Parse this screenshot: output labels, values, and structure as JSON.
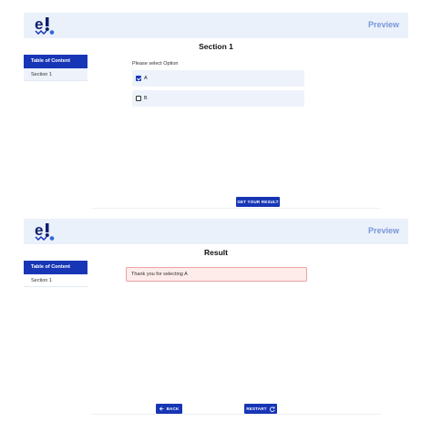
{
  "section_page": {
    "header": {
      "preview_label": "Preview"
    },
    "title": "Section 1",
    "sidebar": {
      "heading": "Table of Content",
      "items": [
        {
          "label": "Section 1"
        }
      ]
    },
    "question": "Please select Option",
    "options": [
      {
        "label": "A",
        "checked": true
      },
      {
        "label": "B",
        "checked": false
      }
    ],
    "submit_label": "GET YOUR RESULT"
  },
  "result_page": {
    "header": {
      "preview_label": "Preview"
    },
    "title": "Result",
    "sidebar": {
      "heading": "Table of Content",
      "items": [
        {
          "label": "Section 1"
        }
      ]
    },
    "message": "Thank you for selecting A",
    "back_label": "BACK",
    "restart_label": "RESTART"
  },
  "colors": {
    "primary": "#1736b6",
    "header_bg": "#eaf1fb",
    "preview_text": "#7a96d8",
    "result_bg": "#fdecea",
    "result_border": "#e8a3a0"
  },
  "icons": {
    "logo": "e!-logo",
    "back": "arrow-left-icon",
    "restart": "refresh-icon"
  }
}
